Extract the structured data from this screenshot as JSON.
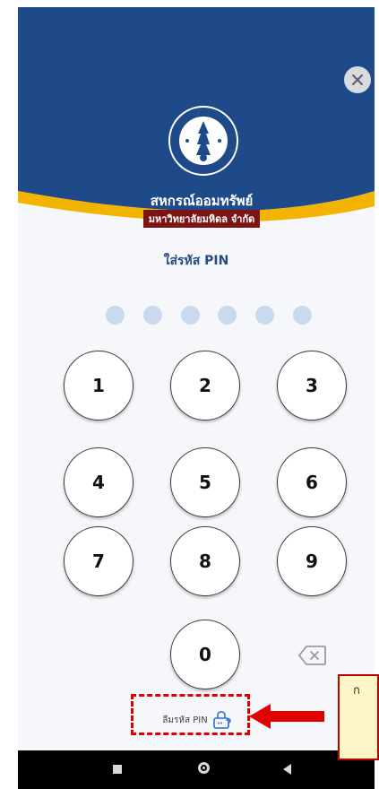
{
  "header": {
    "org_name": "สหกรณ์ออมทรัพย์",
    "org_subname": "มหาวิทยาลัยมหิดล จำกัด",
    "colors": {
      "primary": "#1f4a8a",
      "accent": "#f2b400"
    }
  },
  "close_icon": "close-icon",
  "pin": {
    "title": "ใส่รหัส PIN",
    "length": 6,
    "entered": 0
  },
  "keypad": {
    "keys": [
      "1",
      "2",
      "3",
      "4",
      "5",
      "6",
      "7",
      "8",
      "9",
      "0"
    ],
    "backspace_icon": "backspace-icon"
  },
  "forgot_pin": {
    "label": "ลืมรหัส PIN",
    "icon": "lock-question-icon"
  },
  "navbar": {
    "icons": [
      "recent-apps-icon",
      "home-icon",
      "back-icon"
    ]
  },
  "annotation": {
    "callout_text": "ก",
    "highlight_color": "#e00000"
  }
}
